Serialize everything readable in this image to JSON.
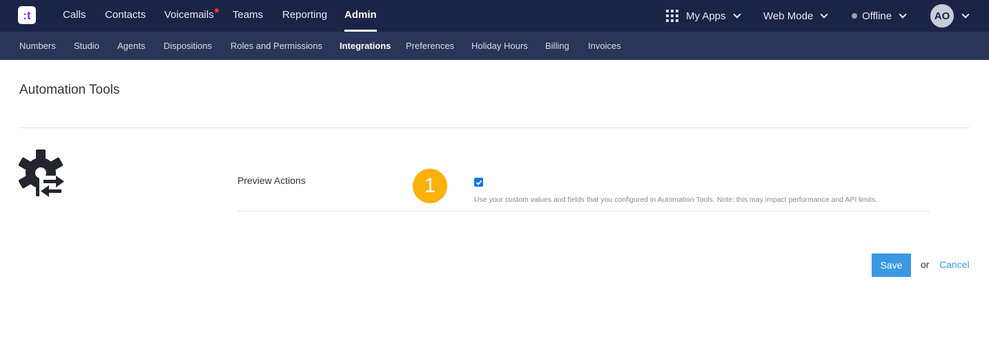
{
  "brand": {
    "logo_glyph": ":t",
    "logo_color": "#7b2ff7"
  },
  "topnav": {
    "items": [
      {
        "label": "Calls"
      },
      {
        "label": "Contacts"
      },
      {
        "label": "Voicemails",
        "has_notification": true
      },
      {
        "label": "Teams"
      },
      {
        "label": "Reporting"
      },
      {
        "label": "Admin",
        "active": true
      }
    ],
    "my_apps": "My Apps",
    "mode": "Web Mode",
    "status": "Offline",
    "avatar_initials": "AO"
  },
  "subnav": {
    "items": [
      {
        "label": "Numbers"
      },
      {
        "label": "Studio"
      },
      {
        "label": "Agents"
      },
      {
        "label": "Dispositions"
      },
      {
        "label": "Roles and Permissions"
      },
      {
        "label": "Integrations",
        "active": true
      },
      {
        "label": "Preferences"
      },
      {
        "label": "Holiday Hours"
      },
      {
        "label": "Billing"
      },
      {
        "label": "Invoices"
      }
    ]
  },
  "page": {
    "title": "Automation Tools",
    "icon": "gear-sync-icon",
    "field": {
      "label": "Preview Actions",
      "step_badge": "1",
      "checked": true,
      "help": "Use your custom values and fields that you configured in Automation Tools. Note: this may impact performance and API limits."
    },
    "actions": {
      "save": "Save",
      "or": "or",
      "cancel": "Cancel"
    }
  },
  "colors": {
    "topbar": "#1b2347",
    "subbar": "#2b3558",
    "accent": "#3b98e5",
    "badge": "#fbb10a"
  }
}
